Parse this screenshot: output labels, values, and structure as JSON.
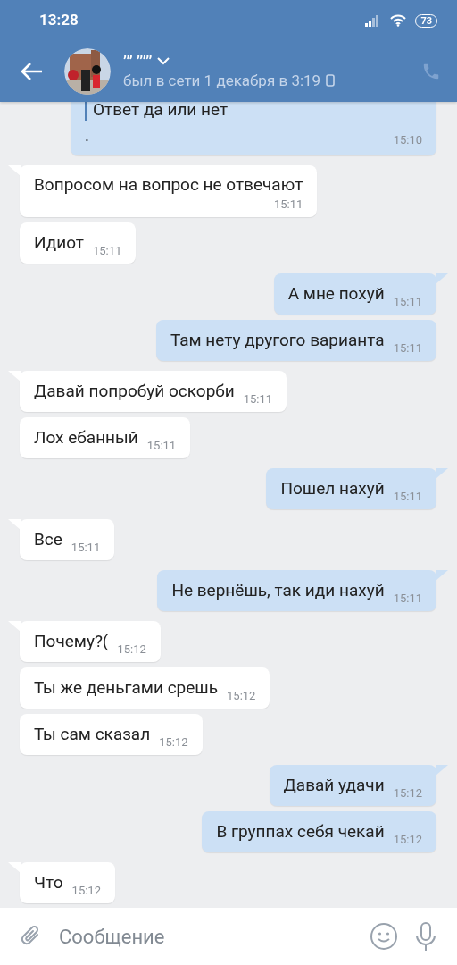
{
  "status_bar": {
    "time": "13:28",
    "battery": "73"
  },
  "header": {
    "name": "’’’ ’’’’’",
    "status": "был в сети 1 декабря в 3:19"
  },
  "messages": [
    {
      "outgoing": true,
      "kind": "quote",
      "quote": "Ответ да или нет",
      "text": ".",
      "time": "15:10"
    },
    {
      "outgoing": false,
      "kind": "wrapped",
      "text": "Вопросом на вопрос не отвечают",
      "time": "15:11",
      "tail": true
    },
    {
      "outgoing": false,
      "kind": "plain",
      "text": "Идиот",
      "time": "15:11",
      "tail": false
    },
    {
      "outgoing": true,
      "kind": "plain",
      "text": "А мне похуй",
      "time": "15:11",
      "tail": true
    },
    {
      "outgoing": true,
      "kind": "plain",
      "text": "Там нету другого варианта",
      "time": "15:11",
      "tail": false
    },
    {
      "outgoing": false,
      "kind": "plain",
      "text": "Давай попробуй оскорби",
      "time": "15:11",
      "tail": true
    },
    {
      "outgoing": false,
      "kind": "plain",
      "text": "Лох ебанный",
      "time": "15:11",
      "tail": false
    },
    {
      "outgoing": true,
      "kind": "plain",
      "text": "Пошел нахуй",
      "time": "15:11",
      "tail": true
    },
    {
      "outgoing": false,
      "kind": "plain",
      "text": "Все",
      "time": "15:11",
      "tail": true
    },
    {
      "outgoing": true,
      "kind": "plain",
      "text": "Не вернёшь, так иди нахуй",
      "time": "15:11",
      "tail": true
    },
    {
      "outgoing": false,
      "kind": "plain",
      "text": "Почему?(",
      "time": "15:12",
      "tail": true
    },
    {
      "outgoing": false,
      "kind": "plain",
      "text": "Ты же деньгами срешь",
      "time": "15:12",
      "tail": false
    },
    {
      "outgoing": false,
      "kind": "plain",
      "text": "Ты сам сказал",
      "time": "15:12",
      "tail": false
    },
    {
      "outgoing": true,
      "kind": "plain",
      "text": "Давай удачи",
      "time": "15:12",
      "tail": true
    },
    {
      "outgoing": true,
      "kind": "plain",
      "text": "В группах себя чекай",
      "time": "15:12",
      "tail": false
    },
    {
      "outgoing": false,
      "kind": "plain",
      "text": "Что",
      "time": "15:12",
      "tail": true
    }
  ],
  "composer": {
    "placeholder": "Сообщение"
  }
}
